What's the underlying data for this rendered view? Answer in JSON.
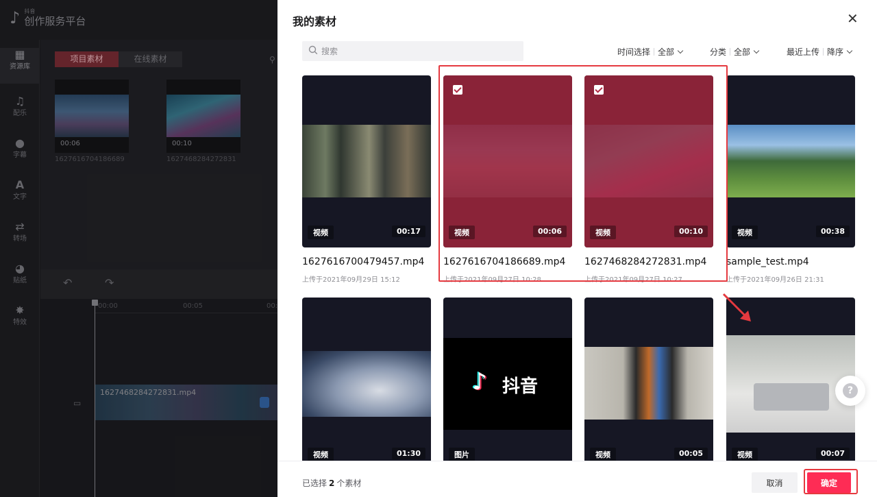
{
  "app": {
    "brand_small": "抖音",
    "brand_title": "创作服务平台"
  },
  "sidebar": {
    "items": [
      {
        "label": "资源库",
        "icon": "grid-icon"
      },
      {
        "label": "配乐",
        "icon": "music-note-icon"
      },
      {
        "label": "字幕",
        "icon": "subtitle-icon"
      },
      {
        "label": "文字",
        "icon": "text-icon"
      },
      {
        "label": "转场",
        "icon": "transition-icon"
      },
      {
        "label": "贴纸",
        "icon": "sticker-icon"
      },
      {
        "label": "特效",
        "icon": "effects-star-icon"
      }
    ]
  },
  "assets": {
    "tabs": [
      {
        "label": "项目素材",
        "active": true
      },
      {
        "label": "在线素材",
        "active": false
      }
    ],
    "items": [
      {
        "duration": "00:06",
        "name": "1627616704186689"
      },
      {
        "duration": "00:10",
        "name": "1627468284272831"
      }
    ]
  },
  "timeline": {
    "ruler": [
      "00:00",
      "00:05",
      "00:"
    ],
    "clip_name": "1627468284272831.mp4"
  },
  "modal": {
    "title": "我的素材",
    "search_placeholder": "搜索",
    "filters": {
      "time_label": "时间选择",
      "time_value": "全部",
      "category_label": "分类",
      "category_value": "全部",
      "sort_label": "最近上传",
      "sort_value": "降序"
    },
    "cards": [
      {
        "type": "视频",
        "duration": "00:17",
        "filename": "1627616700479457.mp4",
        "date": "上传于2021年09月29日 15:12",
        "selected": false
      },
      {
        "type": "视频",
        "duration": "00:06",
        "filename": "1627616704186689.mp4",
        "date": "上传于2021年09月27日 10:28",
        "selected": true
      },
      {
        "type": "视频",
        "duration": "00:10",
        "filename": "1627468284272831.mp4",
        "date": "上传于2021年09月27日 10:27",
        "selected": true
      },
      {
        "type": "视频",
        "duration": "00:38",
        "filename": "sample_test.mp4",
        "date": "上传于2021年09月26日 21:31",
        "selected": false
      },
      {
        "type": "视频",
        "duration": "01:30",
        "filename": "",
        "date": "",
        "selected": false
      },
      {
        "type": "图片",
        "duration": "",
        "filename": "",
        "date": "",
        "selected": false,
        "logo_text": "抖音"
      },
      {
        "type": "视频",
        "duration": "00:05",
        "filename": "",
        "date": "",
        "selected": false
      },
      {
        "type": "视频",
        "duration": "00:07",
        "filename": "",
        "date": "",
        "selected": false
      }
    ],
    "footer": {
      "selected_prefix": "已选择",
      "selected_count": "2",
      "selected_suffix": "个素材",
      "cancel_label": "取消",
      "confirm_label": "确定"
    }
  },
  "colors": {
    "accent": "#fe2c55",
    "selection_overlay": "#ac263e",
    "annotation": "#e5393f"
  }
}
